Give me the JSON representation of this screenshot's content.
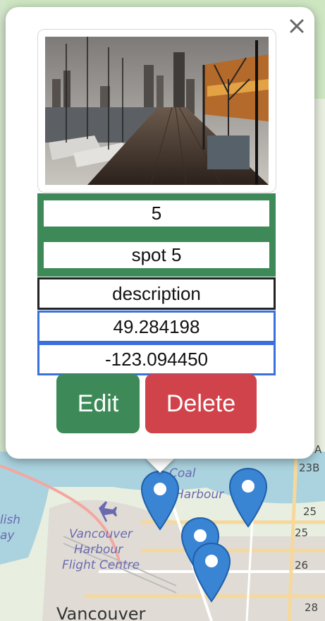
{
  "popup": {
    "close_icon": "close-icon",
    "fields": {
      "id": "5",
      "name": "spot 5",
      "description": "description",
      "latitude": "49.284198",
      "longitude": "-123.094450"
    },
    "edit_label": "Edit",
    "delete_label": "Delete",
    "colors": {
      "green": "#3d8a58",
      "red": "#d1434a",
      "blue_border": "#3b6fdc"
    }
  },
  "map": {
    "labels": {
      "coal_harbour": "Coal Harbour",
      "coal_harbour_partial_1": "Coal",
      "coal_harbour_partial_2": "Harbour",
      "flight_centre_1": "Vancouver",
      "flight_centre_2": "Harbour",
      "flight_centre_3": "Flight Centre",
      "city": "Vancouver",
      "english_bay_1": "lish",
      "english_bay_2": "ay"
    },
    "road_numbers": [
      "A",
      "23B",
      "25",
      "25",
      "26",
      "28"
    ],
    "markers": [
      "map-marker-1",
      "map-marker-2",
      "map-marker-3",
      "map-marker-4"
    ]
  }
}
